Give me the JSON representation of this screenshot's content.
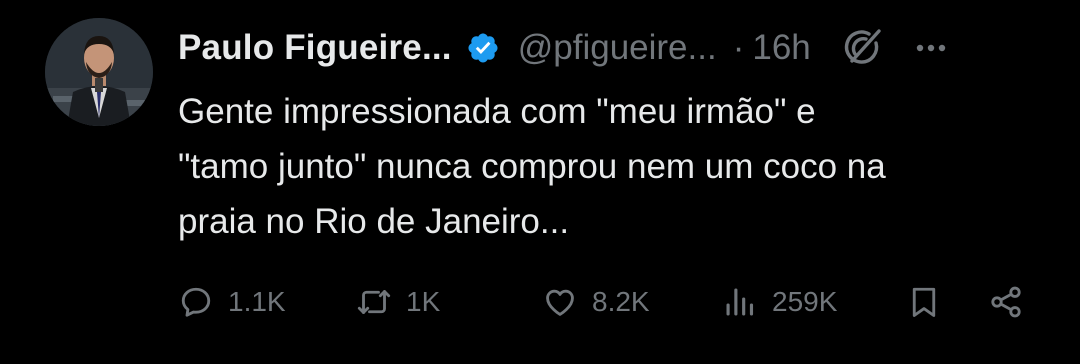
{
  "author": {
    "display_name": "Paulo Figueire...",
    "handle": "@pfigueire...",
    "separator": "·",
    "time": "16h",
    "verified_color": "#1d9bf0"
  },
  "tweet": {
    "lines": [
      "Gente impressionada com \"meu irmão\" e",
      "\"tamo junto\" nunca comprou nem um coco na",
      "praia no Rio de Janeiro..."
    ]
  },
  "actions": {
    "replies": "1.1K",
    "reposts": "1K",
    "likes": "8.2K",
    "views": "259K"
  },
  "icons": {
    "header": [
      "verified-badge-icon",
      "grok-icon",
      "more-icon"
    ],
    "actions": [
      "reply-icon",
      "repost-icon",
      "like-icon",
      "views-icon",
      "bookmark-icon",
      "share-icon"
    ]
  },
  "colors": {
    "background": "#000000",
    "text": "#e7e9ea",
    "muted": "#71767b",
    "verified": "#1d9bf0"
  }
}
